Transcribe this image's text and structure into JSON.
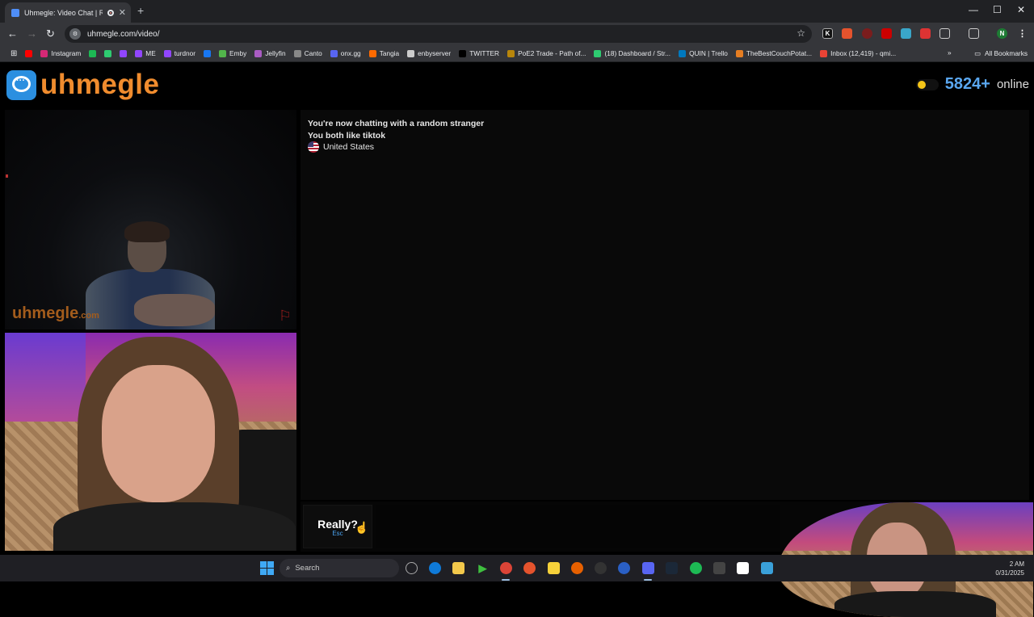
{
  "browser": {
    "tab_title": "Uhmegle: Video Chat | Rand",
    "close_glyph": "✕",
    "new_tab_glyph": "+",
    "url": "uhmegle.com/video/",
    "window_controls": [
      "—",
      "☐",
      "✕"
    ],
    "nav": {
      "back": "←",
      "forward": "→",
      "reload": "↻"
    },
    "bookmark_star": "☆",
    "bookmarks": [
      {
        "label": "",
        "color": "#ff0000"
      },
      {
        "label": "Instagram",
        "color": "#d62976"
      },
      {
        "label": "",
        "color": "#1db954"
      },
      {
        "label": "",
        "color": "#2ecc71"
      },
      {
        "label": "",
        "color": "#9146ff"
      },
      {
        "label": "ME",
        "color": "#9146ff"
      },
      {
        "label": "turdnor",
        "color": "#9146ff"
      },
      {
        "label": "",
        "color": "#1877f2"
      },
      {
        "label": "Emby",
        "color": "#52b54b"
      },
      {
        "label": "Jellyfin",
        "color": "#aa5cc3"
      },
      {
        "label": "Canto",
        "color": "#888888"
      },
      {
        "label": "onx.gg",
        "color": "#5865f2"
      },
      {
        "label": "Tangia",
        "color": "#ff6a00"
      },
      {
        "label": "enbyserver",
        "color": "#cccccc"
      },
      {
        "label": "TWITTER",
        "color": "#000000"
      },
      {
        "label": "PoE2 Trade - Path of...",
        "color": "#b8860b"
      },
      {
        "label": "(18) Dashboard / Str...",
        "color": "#2ecc71"
      },
      {
        "label": "QUIN | Trello",
        "color": "#0079bf"
      },
      {
        "label": "TheBestCouchPotat...",
        "color": "#e67e22"
      },
      {
        "label": "Inbox (12,419) - qmi...",
        "color": "#ea4335"
      }
    ],
    "all_bookmarks": "All Bookmarks",
    "overflow": "»"
  },
  "site": {
    "brand": "uhmegle",
    "online_count": "5824+",
    "online_label": "online",
    "remote_watermark": "uhmegle",
    "remote_watermark_suffix": ".com",
    "chat_lines": [
      "You're now chatting with a random stranger",
      "You both like tiktok"
    ],
    "country": "United States",
    "skip_label": "Really?",
    "skip_hint": "Esc"
  },
  "taskbar": {
    "search_label": "Search",
    "time": "2 AM",
    "date": "0/31/2025"
  }
}
